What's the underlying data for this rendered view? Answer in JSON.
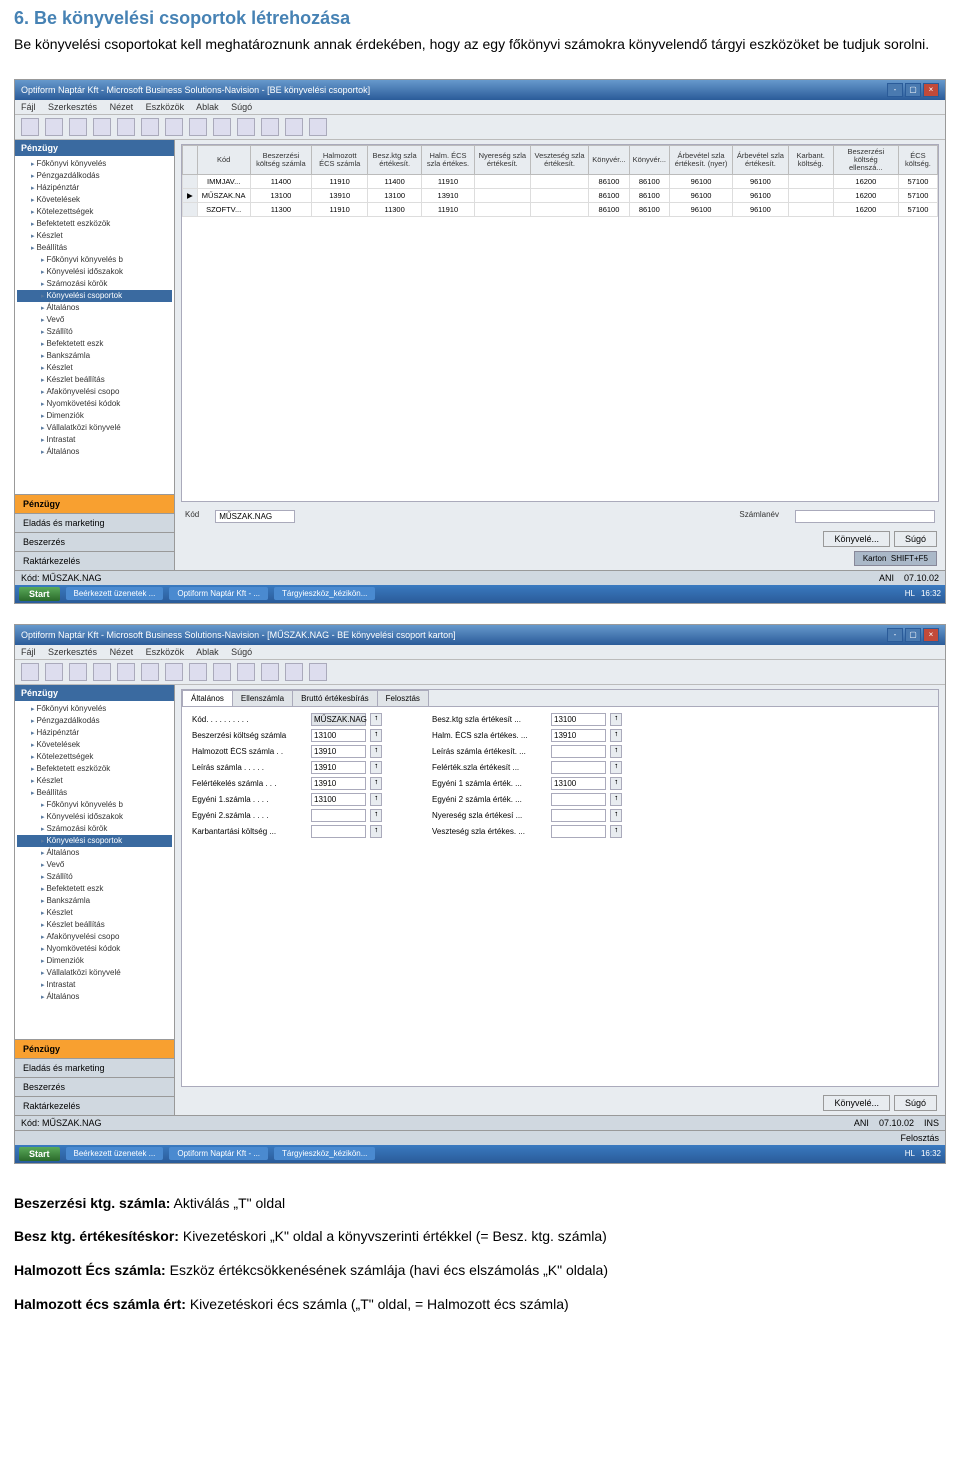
{
  "doc": {
    "heading": "6. Be könyvelési csoportok létrehozása",
    "intro": "Be könyvelési csoportokat kell meghatároznunk annak érdekében, hogy az egy főkönyvi számokra könyvelendő tárgyi eszközöket be tudjuk sorolni."
  },
  "screenshot1": {
    "title": "Optiform Naptár Kft - Microsoft Business Solutions-Navision - [BE könyvelési csoportok]",
    "menu": [
      "Fájl",
      "Szerkesztés",
      "Nézet",
      "Eszközök",
      "Ablak",
      "Súgó"
    ],
    "sidebar_header": "Pénzügy",
    "tree": [
      "Főkönyvi könyvelés",
      "Pénzgazdálkodás",
      "Házipénztár",
      "Követelések",
      "Kötelezettségek",
      "Befektetett eszközök",
      "Készlet",
      "Beállítás",
      "Főkönyvi könyvelés b",
      "Könyvelési időszakok",
      "Számozási körök",
      "Könyvelési csoportok",
      "Általános",
      "Vevő",
      "Szállító",
      "Befektetett eszk",
      "Bankszámla",
      "Készlet",
      "Készlet beállítás",
      "Afakönyvelési csopo",
      "Nyomkövetési kódok",
      "Dimenziók",
      "Vállalatközi könyvelé",
      "Intrastat",
      "Általános"
    ],
    "nav_buttons": [
      "Pénzügy",
      "Eladás és marketing",
      "Beszerzés",
      "Raktárkezelés"
    ],
    "grid_headers": [
      "Kód",
      "Beszerzési költség számla",
      "Halmozott ÉCS számla",
      "Besz.ktg szla értékesít.",
      "Halm. ÉCS szla értékes.",
      "Nyereség szla értékesít.",
      "Veszteség szla értékesít.",
      "Könyvér...",
      "Könyvér...",
      "Árbevétel szla értékesít. (nyer)",
      "Árbevétel szla értékesít.",
      "Karbant. költség.",
      "Beszerzési költség ellenszá...",
      "ÉCS költség."
    ],
    "grid_rows": [
      [
        "IMMJAV...",
        "11400",
        "11910",
        "11400",
        "11910",
        "",
        "",
        "86100",
        "86100",
        "96100",
        "96100",
        "",
        "16200",
        "57100"
      ],
      [
        "MŰSZAK.NA",
        "13100",
        "13910",
        "13100",
        "13910",
        "",
        "",
        "86100",
        "86100",
        "96100",
        "96100",
        "",
        "16200",
        "57100"
      ],
      [
        "SZOFTV...",
        "11300",
        "11910",
        "11300",
        "11910",
        "",
        "",
        "86100",
        "86100",
        "96100",
        "96100",
        "",
        "16200",
        "57100"
      ]
    ],
    "selected_row": 1,
    "detail": {
      "kod_label": "Kód",
      "kod_value": "MŰSZAK.NAG",
      "szamla_label": "Számlanév"
    },
    "buttons": [
      "Könyvelé...",
      "Súgó"
    ],
    "keyhint": {
      "label": "Karton",
      "shortcut": "SHIFT+F5"
    },
    "status_left": "Kód: MŰSZAK.NAG",
    "status_ani": "ANI",
    "status_date": "07.10.02",
    "taskbar_items": [
      "Beérkezett üzenetek ...",
      "Optiform Naptár Kft - ...",
      "Tárgyieszköz_kézikön..."
    ],
    "taskbar_lang": "HL",
    "taskbar_time": "16:32"
  },
  "screenshot2": {
    "title": "Optiform Naptár Kft - Microsoft Business Solutions-Navision - [MŰSZAK.NAG - BE könyvelési csoport karton]",
    "menu": [
      "Fájl",
      "Szerkesztés",
      "Nézet",
      "Eszközök",
      "Ablak",
      "Súgó"
    ],
    "sidebar_header": "Pénzügy",
    "tree": [
      "Főkönyvi könyvelés",
      "Pénzgazdálkodás",
      "Házipénztár",
      "Követelések",
      "Kötelezettségek",
      "Befektetett eszközök",
      "Készlet",
      "Beállítás",
      "Főkönyvi könyvelés b",
      "Könyvelési időszakok",
      "Számozási körök",
      "Könyvelési csoportok",
      "Általános",
      "Vevő",
      "Szállító",
      "Befektetett eszk",
      "Bankszámla",
      "Készlet",
      "Készlet beállítás",
      "Afakönyvelési csopo",
      "Nyomkövetési kódok",
      "Dimenziók",
      "Vállalatközi könyvelé",
      "Intrastat",
      "Általános"
    ],
    "nav_buttons": [
      "Pénzügy",
      "Eladás és marketing",
      "Beszerzés",
      "Raktárkezelés"
    ],
    "tabs": [
      "Általános",
      "Ellenszámla",
      "Bruttó értékesbírás",
      "Felosztás"
    ],
    "fields_left": [
      {
        "label": "Kód. . . . . . . . . .",
        "value": "MŰSZAK.NAG",
        "filled": true
      },
      {
        "label": "Beszerzési költség számla",
        "value": "13100"
      },
      {
        "label": "Halmozott ÉCS számla . .",
        "value": "13910"
      },
      {
        "label": "Leírás számla . . . . .",
        "value": "13910"
      },
      {
        "label": "Felértékelés számla . . .",
        "value": "13910"
      },
      {
        "label": "Egyéni 1.számla . . . .",
        "value": "13100"
      },
      {
        "label": "Egyéni 2.számla . . . .",
        "value": ""
      },
      {
        "label": "Karbantartási költség ...",
        "value": ""
      }
    ],
    "fields_right": [
      {
        "label": "Besz.ktg szla értékesít ...",
        "value": "13100"
      },
      {
        "label": "Halm. ÉCS szla értékes. ...",
        "value": "13910"
      },
      {
        "label": "Leírás számla értékesít. ...",
        "value": ""
      },
      {
        "label": "Felérték.szla értékesít ...",
        "value": ""
      },
      {
        "label": "Egyéni 1 számla érték. ...",
        "value": "13100"
      },
      {
        "label": "Egyéni 2 számla érték. ...",
        "value": ""
      },
      {
        "label": "Nyereség szla értékesí ...",
        "value": ""
      },
      {
        "label": "Veszteség szla értékes. ...",
        "value": ""
      }
    ],
    "buttons": [
      "Könyvelé...",
      "Súgó"
    ],
    "status_left": "Kód: MŰSZAK.NAG",
    "status_ani": "ANI",
    "status_date": "07.10.02",
    "status_mode": "INS",
    "status_mode2": "Felosztás",
    "taskbar_items": [
      "Beérkezett üzenetek ...",
      "Optiform Naptár Kft - ...",
      "Tárgyieszköz_kézikön..."
    ],
    "taskbar_lang": "HL",
    "taskbar_time": "16:32"
  },
  "below": {
    "p1_label": "Beszerzési ktg. számla:",
    "p1_text": " Aktiválás „T\" oldal",
    "p2_label": "Besz ktg. értékesítéskor:",
    "p2_text": " Kivezetéskori „K\" oldal a könyvszerinti értékkel (= Besz. ktg. számla)",
    "p3_label": "Halmozott Écs számla:",
    "p3_text": " Eszköz értékcsökkenésének számlája (havi écs elszámolás „K\" oldala)",
    "p4_label": "Halmozott écs számla ért:",
    "p4_text": " Kivezetéskori écs számla („T\" oldal, = Halmozott écs számla)"
  },
  "start_label": "Start"
}
